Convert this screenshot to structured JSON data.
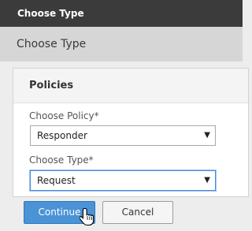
{
  "window": {
    "title": "Choose Type"
  },
  "header": {
    "title": "Choose Type"
  },
  "panel": {
    "title": "Policies",
    "policy_field": {
      "label": "Choose Policy*",
      "value": "Responder",
      "arrow_icon": "triangle-down"
    },
    "type_field": {
      "label": "Choose Type*",
      "value": "Request",
      "arrow_icon": "triangle-down"
    }
  },
  "footer": {
    "continue_label": "Continue",
    "cancel_label": "Cancel"
  },
  "colors": {
    "titlebar_bg": "#3b3b3b",
    "primary_button": "#4a93d6",
    "focus_border": "#4a8bd6"
  }
}
